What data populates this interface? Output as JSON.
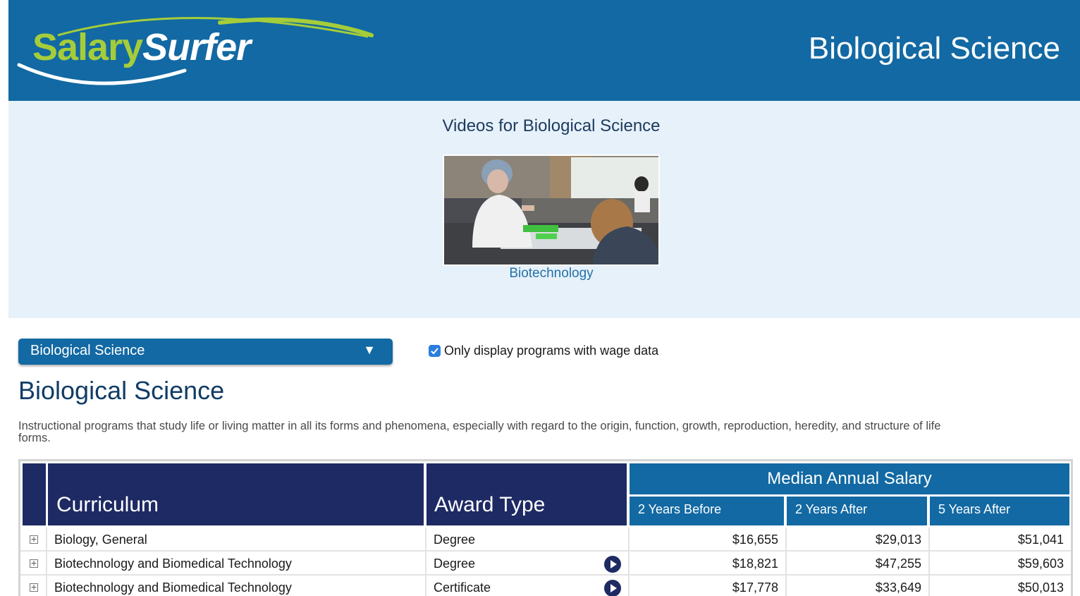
{
  "header": {
    "logo_part1": "Salary",
    "logo_part2": "Surfer",
    "title": "Biological Science",
    "colors": {
      "brand_blue": "#1269a3",
      "logo_green": "#a5cd39",
      "table_navy": "#1e2a63"
    }
  },
  "videos": {
    "heading": "Videos for Biological Science",
    "items": [
      {
        "caption": "Biotechnology"
      }
    ]
  },
  "controls": {
    "program_selected": "Biological Science",
    "dropdown_icon": "triangle-down-icon",
    "wage_filter_label": "Only display programs with wage data",
    "wage_filter_checked": true
  },
  "main": {
    "title": "Biological Science",
    "description": "Instructional programs that study life or living matter in all its forms and phenomena, especially with regard to the origin, function, growth, reproduction, heredity, and structure of life forms."
  },
  "table": {
    "headers": {
      "curriculum": "Curriculum",
      "award_type": "Award Type",
      "median": "Median Annual Salary",
      "col_2_before": "2 Years Before",
      "col_2_after": "2 Years After",
      "col_5_after": "5 Years After"
    },
    "rows": [
      {
        "curriculum": "Biology, General",
        "award": "Degree",
        "has_video": false,
        "y2_before": "$16,655",
        "y2_after": "$29,013",
        "y5_after": "$51,041"
      },
      {
        "curriculum": "Biotechnology and Biomedical Technology",
        "award": "Degree",
        "has_video": true,
        "y2_before": "$18,821",
        "y2_after": "$47,255",
        "y5_after": "$59,603"
      },
      {
        "curriculum": "Biotechnology and Biomedical Technology",
        "award": "Certificate",
        "has_video": true,
        "y2_before": "$17,778",
        "y2_after": "$33,649",
        "y5_after": "$50,013"
      }
    ]
  }
}
